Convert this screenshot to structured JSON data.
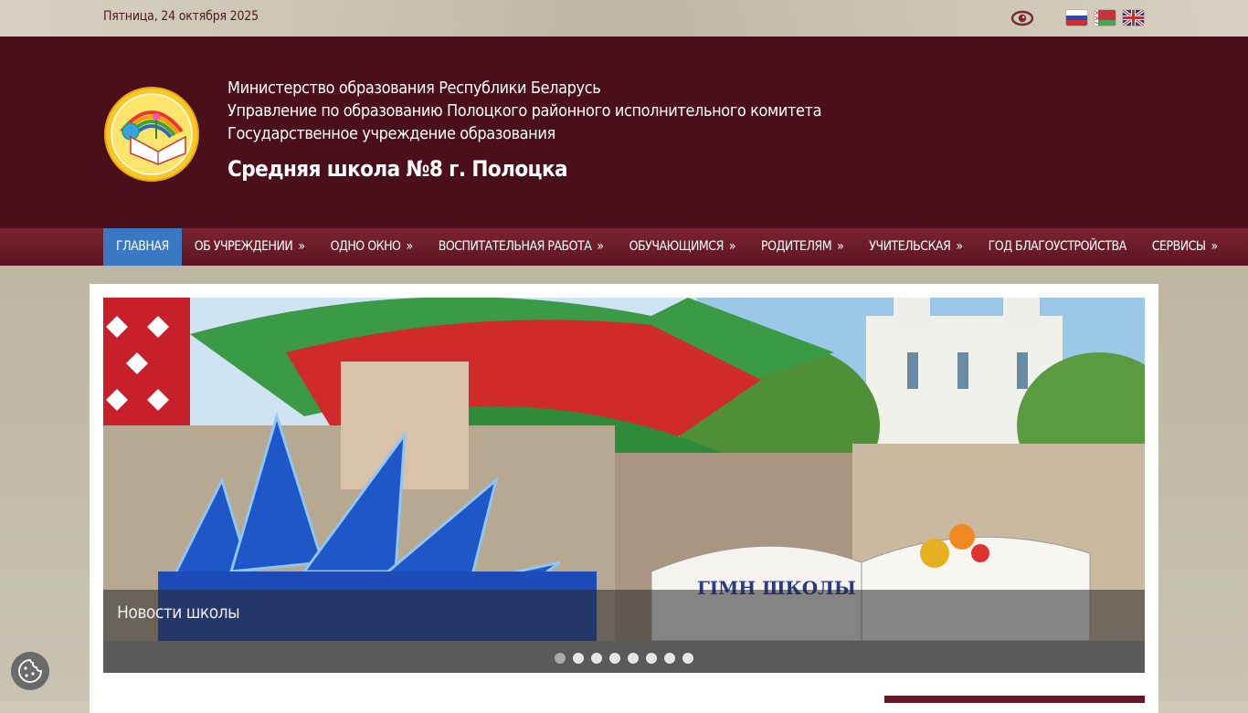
{
  "topbar": {
    "date": "Пятница, 24 октября 2025",
    "accessibility_icon": "eye-icon",
    "languages": [
      "ru-flag-icon",
      "by-flag-icon",
      "gb-flag-icon"
    ]
  },
  "header": {
    "line1": "Министерство образования Республики Беларусь",
    "line2": "Управление по образованию Полоцкого районного исполнительного комитета",
    "line3": "Государственное учреждение образования",
    "title": "Средняя школа №8 г. Полоцка"
  },
  "nav": {
    "items": [
      {
        "label": "ГЛАВНАЯ",
        "arrow": ""
      },
      {
        "label": "ОБ УЧРЕЖДЕНИИ",
        "arrow": "»"
      },
      {
        "label": "ОДНО ОКНО",
        "arrow": "»"
      },
      {
        "label": "ВОСПИТАТЕЛЬНАЯ РАБОТА",
        "arrow": "»"
      },
      {
        "label": "ОБУЧАЮЩИМСЯ",
        "arrow": "»"
      },
      {
        "label": "РОДИТЕЛЯМ",
        "arrow": "»"
      },
      {
        "label": "УЧИТЕЛЬСКАЯ",
        "arrow": "»"
      },
      {
        "label": "ГОД БЛАГОУСТРОЙСТВА",
        "arrow": ""
      },
      {
        "label": "СЕРВИСЫ",
        "arrow": "»"
      }
    ]
  },
  "slider": {
    "caption": "Новости школы",
    "book_heading": "ГІМН ШКОЛЫ",
    "slide_count": 8,
    "active_slide": 1
  },
  "colors": {
    "header_bg": "#4a0f1b",
    "nav_active": "#3a78c3",
    "accent": "#6b1626"
  },
  "cookie_icon": "cookie-icon"
}
